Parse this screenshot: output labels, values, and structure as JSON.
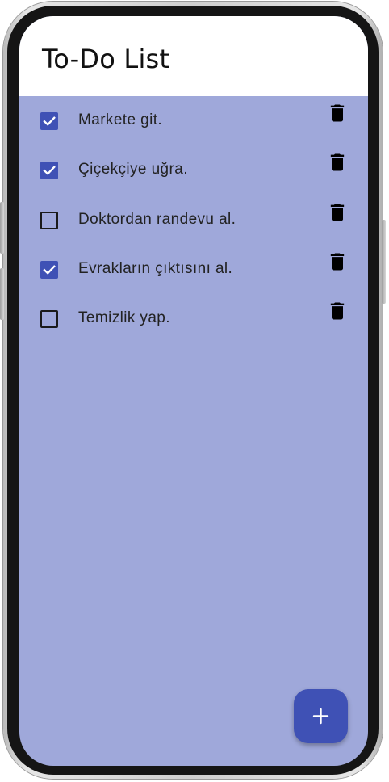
{
  "app_bar": {
    "title": "To-Do List"
  },
  "todos": [
    {
      "label": "Markete git.",
      "checked": true
    },
    {
      "label": "Çiçekçiye uğra.",
      "checked": true
    },
    {
      "label": "Doktordan randevu al.",
      "checked": false
    },
    {
      "label": "Evrakların çıktısını al.",
      "checked": true
    },
    {
      "label": "Temizlik yap.",
      "checked": false
    }
  ],
  "icons": {
    "check": "check-icon",
    "delete": "trash-icon",
    "fab": "plus-icon"
  },
  "colors": {
    "background": "#9FA8DA",
    "accent": "#3F51B5",
    "app_bar": "#FFFFFF"
  }
}
